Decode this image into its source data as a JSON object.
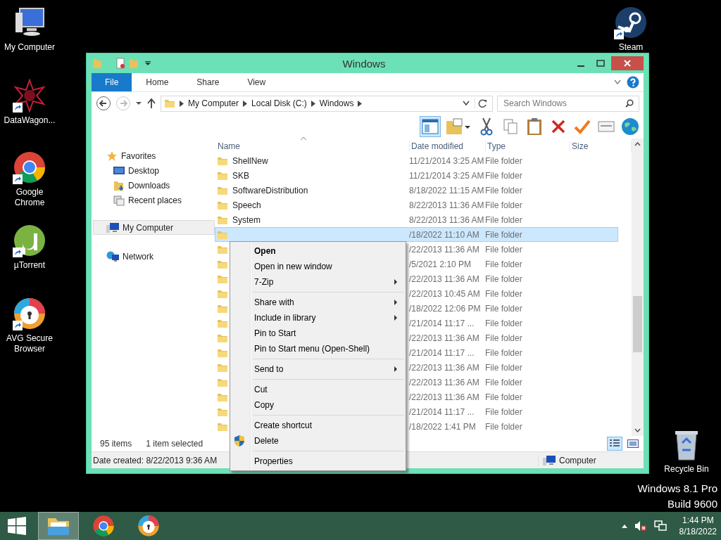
{
  "desktop_icons": [
    {
      "label": "My Computer",
      "kind": "computer",
      "shortcut": false
    },
    {
      "label": "DataWagon...",
      "kind": "star",
      "shortcut": true
    },
    {
      "label": "Google Chrome",
      "kind": "chrome",
      "shortcut": true
    },
    {
      "label": "µTorrent",
      "kind": "torrent",
      "shortcut": true
    },
    {
      "label": "AVG Secure Browser",
      "kind": "avg",
      "shortcut": true
    },
    {
      "label": "Steam",
      "kind": "steam",
      "shortcut": true
    },
    {
      "label": "Recycle Bin",
      "kind": "recycle",
      "shortcut": false
    }
  ],
  "os_watermark": [
    "Windows 8.1 Pro",
    "Build 9600"
  ],
  "window": {
    "title": "Windows",
    "ribbon_tabs": [
      {
        "label": "File",
        "selected": true
      },
      {
        "label": "Home",
        "selected": false
      },
      {
        "label": "Share",
        "selected": false
      },
      {
        "label": "View",
        "selected": false
      }
    ],
    "address": {
      "crumbs": [
        "My Computer",
        "Local Disk (C:)",
        "Windows"
      ]
    },
    "search": {
      "placeholder": "Search Windows"
    },
    "toolbar": [
      {
        "kind": "pane",
        "selected": true
      },
      {
        "kind": "folder",
        "selected": false
      },
      {
        "kind": "cut",
        "selected": false
      },
      {
        "kind": "copy",
        "selected": false
      },
      {
        "kind": "paste",
        "selected": false
      },
      {
        "kind": "delete",
        "selected": false
      },
      {
        "kind": "check",
        "selected": false
      },
      {
        "kind": "mail",
        "selected": false
      },
      {
        "kind": "globe",
        "selected": false
      }
    ],
    "sidebar": [
      {
        "label": "Favorites",
        "kind": "star",
        "selected": false,
        "children": [
          {
            "label": "Desktop",
            "kind": "desktop",
            "selected": false
          },
          {
            "label": "Downloads",
            "kind": "downloads",
            "selected": false
          },
          {
            "label": "Recent places",
            "kind": "recent",
            "selected": false
          }
        ]
      },
      {
        "label": "My Computer",
        "kind": "computer",
        "selected": true
      },
      {
        "label": "Network",
        "kind": "network",
        "selected": false
      }
    ],
    "columns": [
      "Name",
      "Date modified",
      "Type",
      "Size"
    ],
    "rows": [
      {
        "name": "ShellNew",
        "date": "11/21/2014 3:25 AM",
        "type": "File folder",
        "selected": false
      },
      {
        "name": "SKB",
        "date": "11/21/2014 3:25 AM",
        "type": "File folder",
        "selected": false
      },
      {
        "name": "SoftwareDistribution",
        "date": "8/18/2022 11:15 AM",
        "type": "File folder",
        "selected": false
      },
      {
        "name": "Speech",
        "date": "8/22/2013 11:36 AM",
        "type": "File folder",
        "selected": false
      },
      {
        "name": "System",
        "date": "8/22/2013 11:36 AM",
        "type": "File folder",
        "selected": false
      },
      {
        "date": "/18/2022 11:10 AM",
        "type": "File folder",
        "selected": true
      },
      {
        "date": "/22/2013 11:36 AM",
        "type": "File folder",
        "selected": false
      },
      {
        "date": "/5/2021 2:10 PM",
        "type": "File folder",
        "selected": false
      },
      {
        "date": "/22/2013 11:36 AM",
        "type": "File folder",
        "selected": false
      },
      {
        "date": "/22/2013 10:45 AM",
        "type": "File folder",
        "selected": false
      },
      {
        "date": "/18/2022 12:06 PM",
        "type": "File folder",
        "selected": false
      },
      {
        "date": "/21/2014 11:17 ...",
        "type": "File folder",
        "selected": false
      },
      {
        "date": "/22/2013 11:36 AM",
        "type": "File folder",
        "selected": false
      },
      {
        "date": "/21/2014 11:17 ...",
        "type": "File folder",
        "selected": false
      },
      {
        "date": "/22/2013 11:36 AM",
        "type": "File folder",
        "selected": false
      },
      {
        "date": "/22/2013 11:36 AM",
        "type": "File folder",
        "selected": false
      },
      {
        "date": "/22/2013 11:36 AM",
        "type": "File folder",
        "selected": false
      },
      {
        "date": "/21/2014 11:17 ...",
        "type": "File folder",
        "selected": false
      },
      {
        "date": "/18/2022 1:41 PM",
        "type": "File folder",
        "selected": false
      }
    ],
    "status": {
      "items": "95 items",
      "selection": "1 item selected",
      "views": [
        {
          "kind": "details",
          "selected": true
        },
        {
          "kind": "tiles",
          "selected": false
        }
      ]
    },
    "details_bar": {
      "text": "Date created: 8/22/2013 9:36 AM",
      "location": "Computer"
    }
  },
  "context_menu": [
    {
      "kind": "item",
      "label": "Open",
      "default": true,
      "submenu": false,
      "shield": false
    },
    {
      "kind": "item",
      "label": "Open in new window",
      "default": false,
      "submenu": false,
      "shield": false
    },
    {
      "kind": "item",
      "label": "7-Zip",
      "default": false,
      "submenu": true,
      "shield": false
    },
    {
      "kind": "separator"
    },
    {
      "kind": "item",
      "label": "Share with",
      "default": false,
      "submenu": true,
      "shield": false
    },
    {
      "kind": "item",
      "label": "Include in library",
      "default": false,
      "submenu": true,
      "shield": false
    },
    {
      "kind": "item",
      "label": "Pin to Start",
      "default": false,
      "submenu": false,
      "shield": false
    },
    {
      "kind": "item",
      "label": "Pin to Start menu (Open-Shell)",
      "default": false,
      "submenu": false,
      "shield": false
    },
    {
      "kind": "separator"
    },
    {
      "kind": "item",
      "label": "Send to",
      "default": false,
      "submenu": true,
      "shield": false
    },
    {
      "kind": "separator"
    },
    {
      "kind": "item",
      "label": "Cut",
      "default": false,
      "submenu": false,
      "shield": false
    },
    {
      "kind": "item",
      "label": "Copy",
      "default": false,
      "submenu": false,
      "shield": false
    },
    {
      "kind": "separator"
    },
    {
      "kind": "item",
      "label": "Create shortcut",
      "default": false,
      "submenu": false,
      "shield": false
    },
    {
      "kind": "item",
      "label": "Delete",
      "default": false,
      "submenu": false,
      "shield": true
    },
    {
      "kind": "separator"
    },
    {
      "kind": "item",
      "label": "Properties",
      "default": false,
      "submenu": false,
      "shield": false
    }
  ],
  "taskbar": {
    "apps": [
      {
        "kind": "explorer",
        "active": true
      },
      {
        "kind": "chrome",
        "active": false
      },
      {
        "kind": "avg",
        "active": false
      }
    ],
    "time": "1:44 PM",
    "date": "8/18/2022"
  }
}
